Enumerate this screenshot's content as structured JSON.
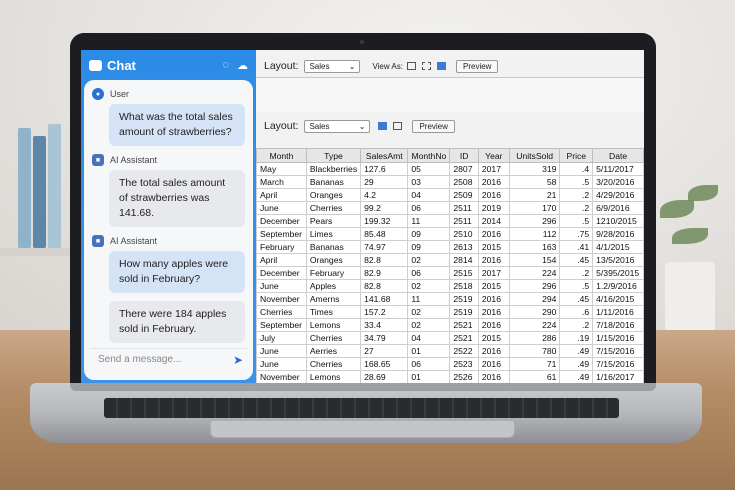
{
  "chat": {
    "title": "Chat",
    "messages": [
      {
        "sender": "User",
        "role": "user",
        "text": "What was the total sales amount of strawberries?"
      },
      {
        "sender": "AI Assistant",
        "role": "ai",
        "text": "The total sales amount of strawberries was 141.68."
      },
      {
        "sender": "AI Assistant",
        "role": "user",
        "text": "How many apples were sold in February?"
      },
      {
        "sender": "",
        "role": "ai",
        "text": "There were 184 apples sold in February."
      }
    ],
    "input_placeholder": "Send a message..."
  },
  "toolbar_top": {
    "layout_label": "Layout:",
    "layout_value": "Sales",
    "view_as_label": "View As:",
    "preview_label": "Preview"
  },
  "toolbar_second": {
    "layout_label": "Layout:",
    "layout_value": "Sales",
    "preview_label": "Preview"
  },
  "table": {
    "columns": [
      "Month",
      "Type",
      "SalesAmt",
      "MonthNo",
      "ID",
      "Year",
      "UnitsSold",
      "Price",
      "Date"
    ],
    "rows": [
      [
        "May",
        "Blackberries",
        "127.6",
        "05",
        "2807",
        "2017",
        "319",
        ".4",
        "5/11/2017"
      ],
      [
        "March",
        "Bananas",
        "29",
        "03",
        "2508",
        "2016",
        "58",
        ".5",
        "3/20/2016"
      ],
      [
        "April",
        "Oranges",
        "4.2",
        "04",
        "2509",
        "2016",
        "21",
        ".2",
        "4/29/2016"
      ],
      [
        "June",
        "Cherries",
        "99.2",
        "06",
        "2511",
        "2019",
        "170",
        ".2",
        "6/9/2016"
      ],
      [
        "December",
        "Pears",
        "199.32",
        "11",
        "2511",
        "2014",
        "296",
        ".5",
        "1210/2015"
      ],
      [
        "September",
        "Limes",
        "85.48",
        "09",
        "2510",
        "2016",
        "112",
        ".75",
        "9/28/2016"
      ],
      [
        "February",
        "Bananas",
        "74.97",
        "09",
        "2613",
        "2015",
        "163",
        ".41",
        "4/1/2015"
      ],
      [
        "April",
        "Oranges",
        "82.8",
        "02",
        "2814",
        "2016",
        "154",
        ".45",
        "13/5/2016"
      ],
      [
        "December",
        "February",
        "82.9",
        "06",
        "2515",
        "2017",
        "224",
        ".2",
        "5/395/2015"
      ],
      [
        "June",
        "Apples",
        "82.8",
        "02",
        "2518",
        "2015",
        "296",
        ".5",
        "1.2/9/2016"
      ],
      [
        "November",
        "Amerns",
        "141.68",
        "11",
        "2519",
        "2016",
        "294",
        ".45",
        "4/16/2015"
      ],
      [
        "Cherries",
        "Times",
        "157.2",
        "02",
        "2519",
        "2016",
        "290",
        ".6",
        "1/11/2016"
      ],
      [
        "September",
        "Lemons",
        "33.4",
        "02",
        "2521",
        "2016",
        "224",
        ".2",
        "7/18/2016"
      ],
      [
        "July",
        "Cherries",
        "34.79",
        "04",
        "2521",
        "2015",
        "286",
        ".19",
        "1/15/2016"
      ],
      [
        "June",
        "Aerries",
        "27",
        "01",
        "2522",
        "2016",
        "780",
        ".49",
        "7/15/2016"
      ],
      [
        "June",
        "Cherries",
        "168.65",
        "06",
        "2523",
        "2016",
        "71",
        ".49",
        "7/15/2016"
      ],
      [
        "November",
        "Lemons",
        "28.69",
        "01",
        "2526",
        "2016",
        "61",
        ".49",
        "1/16/2017"
      ]
    ]
  },
  "colors": {
    "chat_header": "#2c8be6",
    "user_bubble": "#d5e3f6",
    "ai_bubble": "#e8e9ec",
    "accent": "#2c6fd1"
  }
}
